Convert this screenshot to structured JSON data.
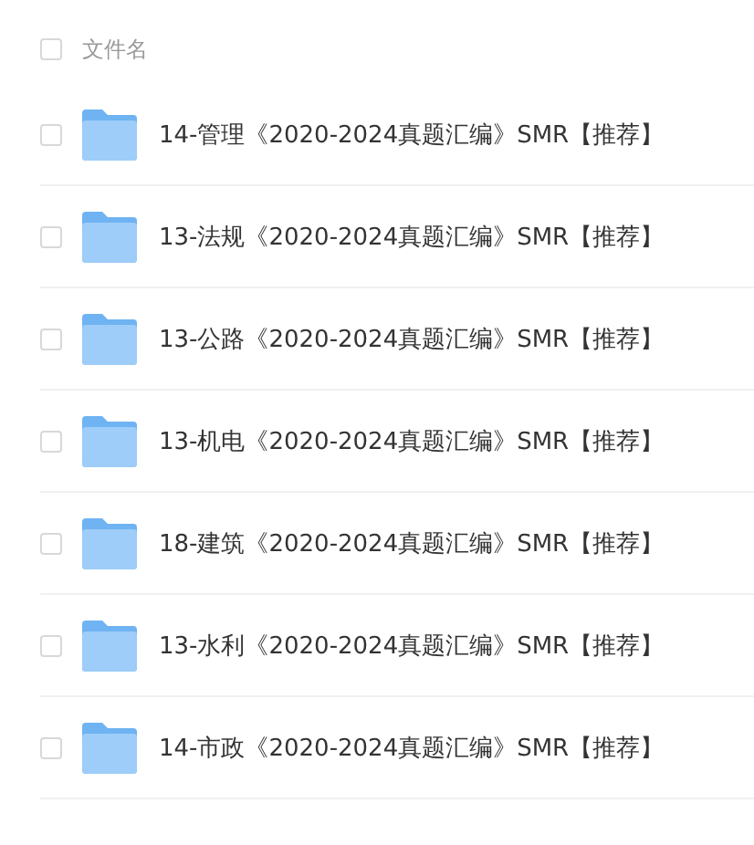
{
  "header": {
    "label": "文件名",
    "checked": false
  },
  "files": [
    {
      "name": "14-管理《2020-2024真题汇编》SMR【推荐】",
      "checked": false
    },
    {
      "name": "13-法规《2020-2024真题汇编》SMR【推荐】",
      "checked": false
    },
    {
      "name": "13-公路《2020-2024真题汇编》SMR【推荐】",
      "checked": false
    },
    {
      "name": "13-机电《2020-2024真题汇编》SMR【推荐】",
      "checked": false
    },
    {
      "name": "18-建筑《2020-2024真题汇编》SMR【推荐】",
      "checked": false
    },
    {
      "name": "13-水利《2020-2024真题汇编》SMR【推荐】",
      "checked": false
    },
    {
      "name": "14-市政《2020-2024真题汇编》SMR【推荐】",
      "checked": false
    }
  ]
}
